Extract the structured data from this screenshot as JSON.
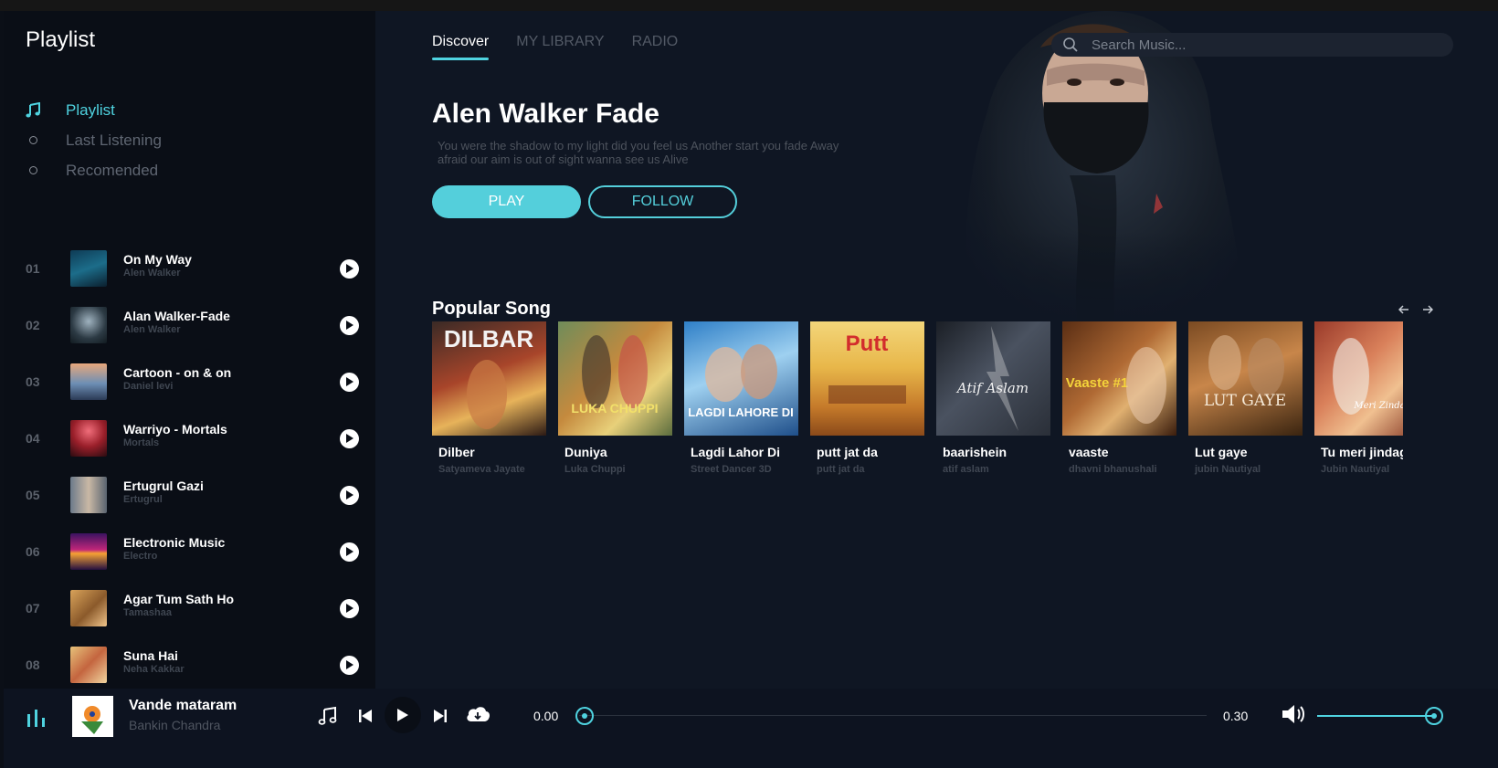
{
  "sidebar": {
    "title": "Playlist",
    "nav": [
      {
        "label": "Playlist",
        "icon": "music-note-icon",
        "active": true
      },
      {
        "label": "Last Listening",
        "icon": "circle-bullet-icon",
        "active": false
      },
      {
        "label": "Recomended",
        "icon": "circle-bullet-icon",
        "active": false
      }
    ],
    "tracks": [
      {
        "num": "01",
        "title": "On My Way",
        "artist": "Alen Walker"
      },
      {
        "num": "02",
        "title": "Alan Walker-Fade",
        "artist": "Alen Walker"
      },
      {
        "num": "03",
        "title": "Cartoon - on & on",
        "artist": "Daniel levi"
      },
      {
        "num": "04",
        "title": "Warriyo - Mortals",
        "artist": "Mortals"
      },
      {
        "num": "05",
        "title": "Ertugrul Gazi",
        "artist": "Ertugrul"
      },
      {
        "num": "06",
        "title": "Electronic Music",
        "artist": "Electro"
      },
      {
        "num": "07",
        "title": "Agar Tum Sath Ho",
        "artist": "Tamashaa"
      },
      {
        "num": "08",
        "title": "Suna Hai",
        "artist": "Neha Kakkar"
      }
    ]
  },
  "header": {
    "tabs": [
      {
        "label": "Discover",
        "active": true
      },
      {
        "label": "MY LIBRARY",
        "active": false
      },
      {
        "label": "RADIO",
        "active": false
      }
    ],
    "search_placeholder": "Search Music..."
  },
  "hero": {
    "title": "Alen Walker Fade",
    "description": "You were the shadow to my light did you feel us Another start you fade Away afraid our aim is out of sight wanna see us Alive",
    "play_label": "PLAY",
    "follow_label": "FOLLOW"
  },
  "popular": {
    "title": "Popular Song",
    "songs": [
      {
        "name": "Dilber",
        "artist": "Satyameva Jayate",
        "cover_text": "DILBAR"
      },
      {
        "name": "Duniya",
        "artist": "Luka Chuppi",
        "cover_text": "LUKA CHUPPI"
      },
      {
        "name": "Lagdi Lahor Di",
        "artist": "Street Dancer 3D",
        "cover_text": "LAGDI LAHORE DI"
      },
      {
        "name": "putt jat da",
        "artist": "putt jat da",
        "cover_text": "Putt"
      },
      {
        "name": "baarishein",
        "artist": "atif aslam",
        "cover_text": "Atif Aslam"
      },
      {
        "name": "vaaste",
        "artist": "dhavni bhanushali",
        "cover_text": "Vaaste #1"
      },
      {
        "name": "Lut gaye",
        "artist": "jubin Nautiyal",
        "cover_text": "LUT GAYE"
      },
      {
        "name": "Tu meri jindagi hai",
        "artist": "Jubin Nautiyal",
        "cover_text": "Meri Zindagi Hai Tu"
      }
    ]
  },
  "player": {
    "title": "Vande mataram",
    "artist": "Bankin Chandra",
    "current_time": "0.00",
    "total_time": "0.30",
    "progress": 0,
    "volume": 1.0
  },
  "colors": {
    "accent": "#4fd3e0",
    "background": "#0f1623",
    "sidebar": "#0a0e16"
  }
}
